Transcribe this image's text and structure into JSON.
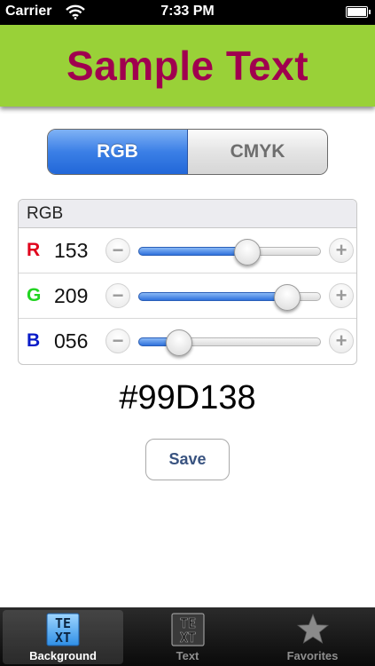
{
  "status_bar": {
    "carrier": "Carrier",
    "time": "7:33 PM"
  },
  "header": {
    "sample_text": "Sample Text",
    "background_color": "#99D138",
    "text_color": "#A0004F"
  },
  "mode_control": {
    "options": [
      "RGB",
      "CMYK"
    ],
    "selected": "RGB"
  },
  "rgb_panel": {
    "title": "RGB",
    "channels": [
      {
        "letter": "R",
        "value": "153",
        "color": "#E0001B",
        "level": 0.6
      },
      {
        "letter": "G",
        "value": "209",
        "color": "#22D422",
        "level": 0.82
      },
      {
        "letter": "B",
        "value": "056",
        "color": "#0A1CC8",
        "level": 0.22
      }
    ],
    "minus_symbol": "−",
    "plus_symbol": "+"
  },
  "hex_value": "#99D138",
  "save_label": "Save",
  "tabs": [
    {
      "label": "Background",
      "icon": "text-tile-icon",
      "active": true,
      "icon_text": [
        "TE",
        "XT"
      ]
    },
    {
      "label": "Text",
      "icon": "text-tile-icon",
      "active": false,
      "icon_text": [
        "TE",
        "XT"
      ]
    },
    {
      "label": "Favorites",
      "icon": "star-icon",
      "active": false
    }
  ]
}
